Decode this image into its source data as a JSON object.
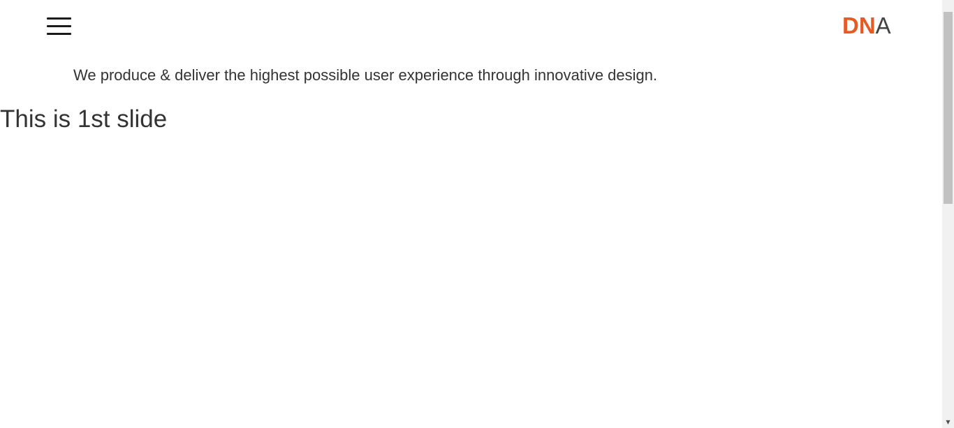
{
  "header": {
    "menu_icon": "hamburger-menu-icon",
    "logo": {
      "part_brand": "DN",
      "part_rest": "A",
      "brand_color": "#e85a24"
    }
  },
  "main": {
    "tagline": "We produce & deliver the highest possible user experience through innovative design.",
    "slide_title": "This is 1st slide"
  },
  "scrollbar": {
    "down_arrow_icon": "chevron-down-icon",
    "down_arrow_glyph": "▼"
  }
}
